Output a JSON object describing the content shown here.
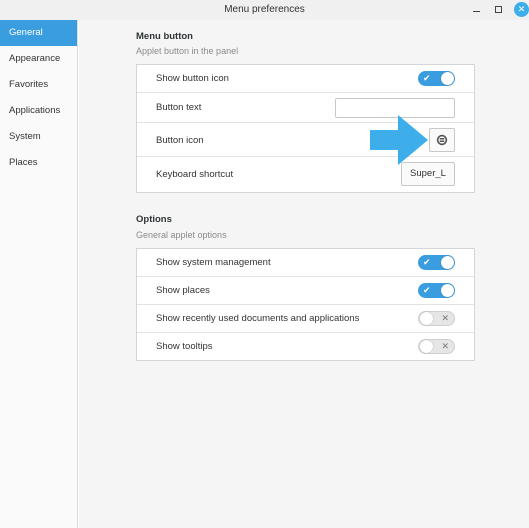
{
  "window": {
    "title": "Menu preferences",
    "close_glyph": "✕"
  },
  "sidebar": {
    "items": [
      {
        "label": "General",
        "active": true
      },
      {
        "label": "Appearance"
      },
      {
        "label": "Favorites"
      },
      {
        "label": "Applications"
      },
      {
        "label": "System"
      },
      {
        "label": "Places"
      }
    ]
  },
  "menu_button": {
    "title": "Menu button",
    "subtitle": "Applet button in the panel",
    "show_icon": {
      "label": "Show button icon",
      "value": true
    },
    "button_text": {
      "label": "Button text",
      "value": ""
    },
    "button_icon": {
      "label": "Button icon",
      "icon": "menu-applet-icon"
    },
    "shortcut": {
      "label": "Keyboard shortcut",
      "value": "Super_L"
    }
  },
  "options": {
    "title": "Options",
    "subtitle": "General applet options",
    "items": [
      {
        "label": "Show system management",
        "value": true
      },
      {
        "label": "Show places",
        "value": true
      },
      {
        "label": "Show recently used documents and applications",
        "value": false
      },
      {
        "label": "Show tooltips",
        "value": false
      }
    ]
  },
  "toggle_marks": {
    "on": "✔",
    "off": "✕"
  },
  "colors": {
    "accent": "#3a9de0",
    "arrow": "#3daee9"
  }
}
